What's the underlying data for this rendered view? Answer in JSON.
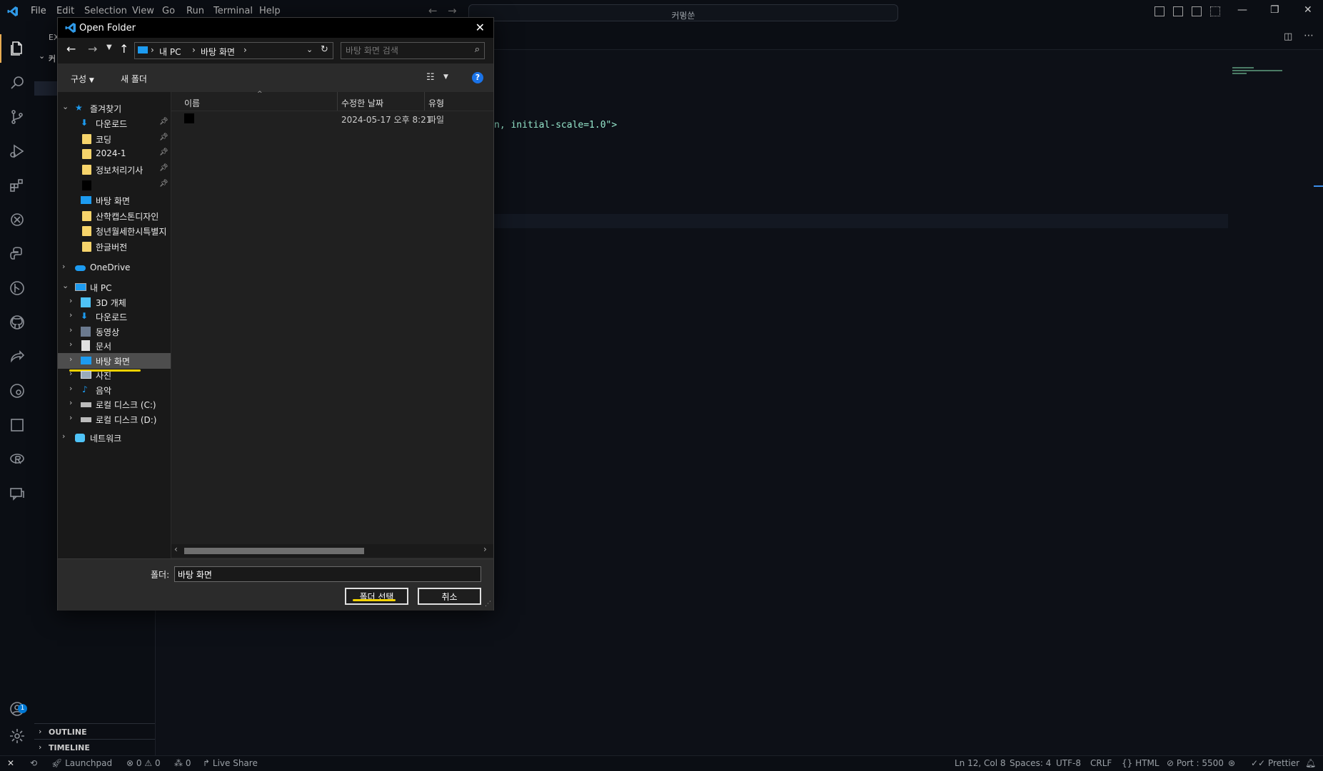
{
  "menu": [
    "File",
    "Edit",
    "Selection",
    "View",
    "Go",
    "Run",
    "Terminal",
    "Help"
  ],
  "command_center": "커밍쑨",
  "sidebar": {
    "explorer_label": "EX",
    "tree_label": "커",
    "outline": "OUTLINE",
    "timeline": "TIMELINE"
  },
  "editor": {
    "code_fragment": "n, initial-scale=1.0\">"
  },
  "dialog": {
    "title": "Open Folder",
    "breadcrumb": [
      "내 PC",
      "바탕 화면"
    ],
    "search_placeholder": "바탕 화면 검색",
    "organize": "구성",
    "new_folder": "새 폴더",
    "columns": [
      "이름",
      "수정한 날짜",
      "유형"
    ],
    "files": [
      {
        "name": "",
        "modified": "2024-05-17 오후 8:21",
        "type": "파일"
      }
    ],
    "nav": {
      "quick_access": "즐겨찾기",
      "quick_items": [
        "다운로드",
        "코딩",
        "2024-1",
        "정보처리기사",
        "",
        "바탕 화면",
        "산학캡스톤디자인",
        "청년월세한시특별지",
        "한글버전"
      ],
      "onedrive": "OneDrive",
      "this_pc": "내 PC",
      "pc_items": [
        "3D 개체",
        "다운로드",
        "동영상",
        "문서",
        "바탕 화면",
        "사진",
        "음악",
        "로컬 디스크 (C:)",
        "로컬 디스크 (D:)"
      ],
      "network": "네트워크"
    },
    "folder_label": "폴더:",
    "folder_value": "바탕 화면",
    "select_button": "폴더 선택",
    "cancel_button": "취소"
  },
  "statusbar": {
    "launchpad": "Launchpad",
    "errors": "0",
    "warnings": "0",
    "ports": "0",
    "liveshare": "Live Share",
    "position": "Ln 12, Col 8",
    "spaces": "Spaces: 4",
    "encoding": "UTF-8",
    "eol": "CRLF",
    "language": "HTML",
    "port": "Port : 5500",
    "prettier": "Prettier"
  },
  "colors": {
    "accent": "#0078d4",
    "highlight_underline": "#f2d200"
  }
}
